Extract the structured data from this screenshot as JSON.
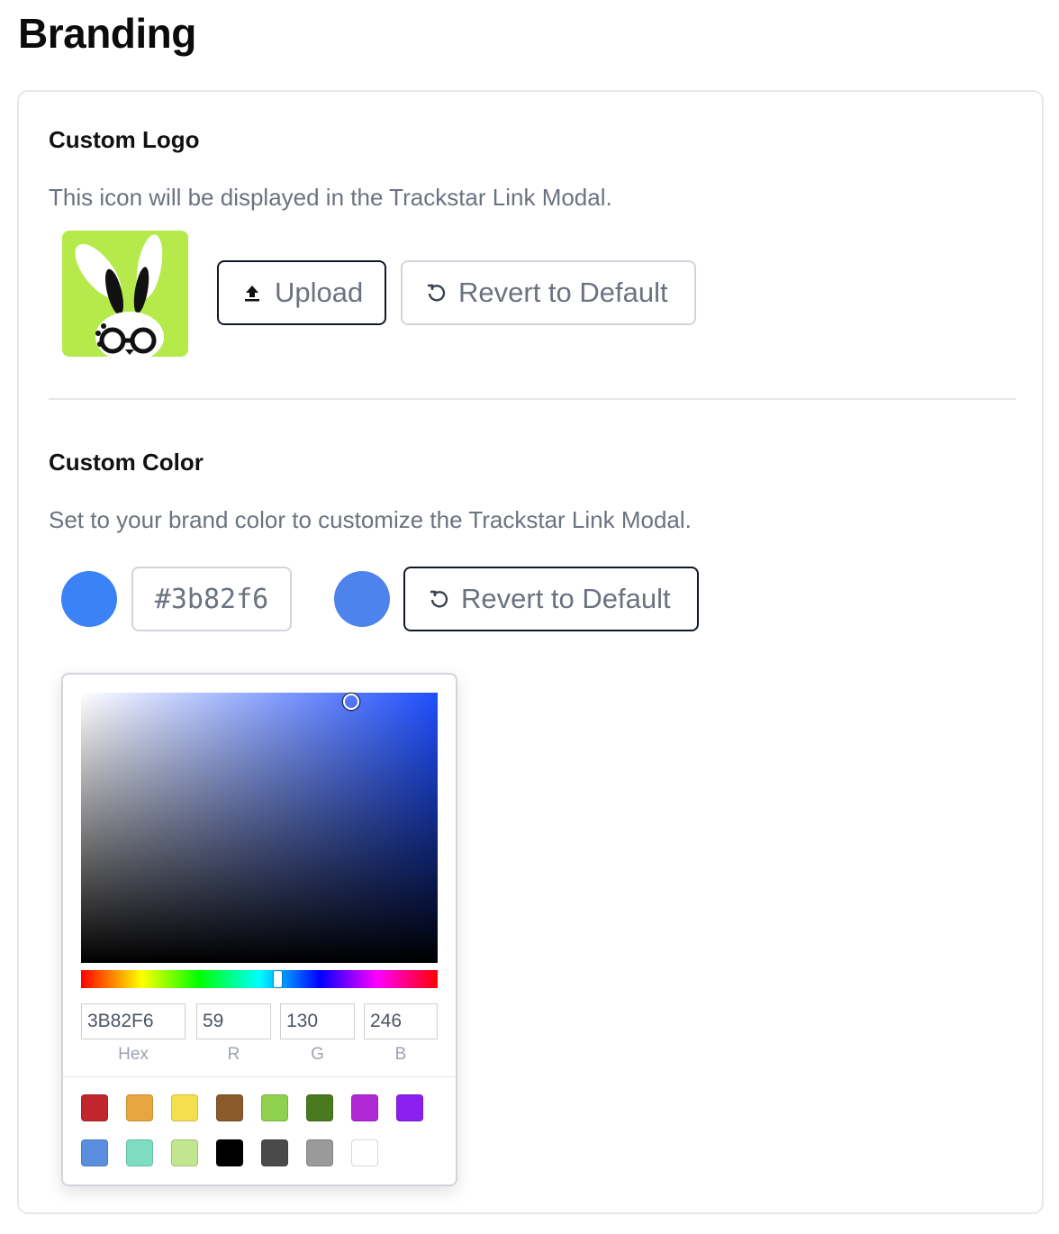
{
  "page": {
    "title": "Branding"
  },
  "logo_section": {
    "title": "Custom Logo",
    "description": "This icon will be displayed in the Trackstar Link Modal.",
    "logo_background": "#b5ea4a",
    "upload_button": {
      "label": "Upload",
      "icon": "upload-icon"
    },
    "revert_button": {
      "label": "Revert to Default",
      "icon": "revert-icon"
    }
  },
  "color_section": {
    "title": "Custom Color",
    "description": "Set to your brand color to customize the Trackstar Link Modal.",
    "current_color": "#3b82f6",
    "hex_value": "#3b82f6",
    "default_preview_color": "#4f83ec",
    "revert_button": {
      "label": "Revert to Default",
      "icon": "revert-icon"
    }
  },
  "color_picker": {
    "hue_color": "#1f4fff",
    "fields": [
      {
        "value": "3B82F6",
        "label": "Hex"
      },
      {
        "value": "59",
        "label": "R"
      },
      {
        "value": "130",
        "label": "G"
      },
      {
        "value": "246",
        "label": "B"
      }
    ],
    "preset_colors": [
      "#c0272d",
      "#e8a640",
      "#f4e04d",
      "#8b5a2b",
      "#8fd14f",
      "#4a7a1f",
      "#b029d6",
      "#8a1ff0",
      "#5a8fdf",
      "#7dddc1",
      "#c1e68f",
      "#000000",
      "#4a4a4a",
      "#9a9a9a",
      "#ffffff"
    ]
  }
}
